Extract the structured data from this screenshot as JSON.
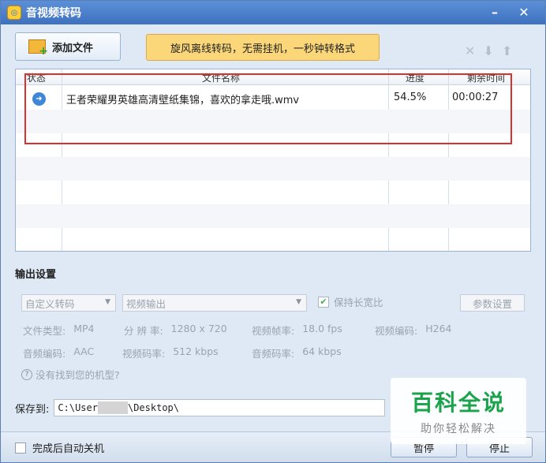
{
  "window": {
    "title": "音视频转码"
  },
  "titlebar": {
    "min_icon": "–",
    "close_icon": "✕"
  },
  "toolbar": {
    "add_file_label": "添加文件",
    "promo_text": "旋风离线转码，无需挂机，一秒钟转格式",
    "icons": [
      "delete-icon",
      "move-down-icon",
      "move-up-icon"
    ]
  },
  "grid": {
    "headers": {
      "status": "状态",
      "filename": "文件名称",
      "progress": "进度",
      "remaining": "剩余时间"
    },
    "rows": [
      {
        "filename": "王者荣耀男英雄高清壁纸集锦，喜欢的拿走哦.wmv",
        "progress": "54.5%",
        "remaining": "00:00:27"
      }
    ]
  },
  "output": {
    "title": "输出设置",
    "preset": "自定义转码",
    "target": "视频输出",
    "keep_ratio_label": "保持长宽比",
    "param_button": "参数设置",
    "file_type_label": "文件类型:",
    "file_type_value": "MP4",
    "resolution_label": "分 辨 率:",
    "resolution_value": "1280 x 720",
    "framerate_label": "视频帧率:",
    "framerate_value": "18.0 fps",
    "vcodec_label": "视频编码:",
    "vcodec_value": "H264",
    "acodec_label": "音频编码:",
    "acodec_value": "AAC",
    "vbitrate_label": "视频码率:",
    "vbitrate_value": "512 kbps",
    "abitrate_label": "音频码率:",
    "abitrate_value": "64 kbps",
    "help_text": "没有找到您的机型?"
  },
  "save": {
    "label": "保存到:",
    "path_prefix": "C:\\User",
    "path_suffix": "\\Desktop\\"
  },
  "footer": {
    "auto_shutdown_label": "完成后自动关机",
    "pause_label": "暂停",
    "stop_label": "停止"
  },
  "watermark": {
    "main": "百科全说",
    "sub": "助你轻松解决"
  }
}
